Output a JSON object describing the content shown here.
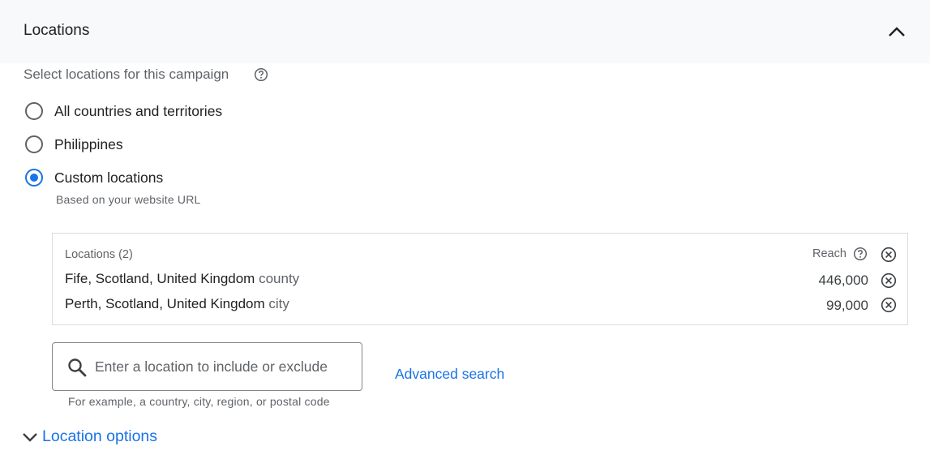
{
  "section": {
    "title": "Locations",
    "subtitle": "Select locations for this campaign"
  },
  "radios": {
    "options": [
      {
        "label": "All countries and territories",
        "checked": false
      },
      {
        "label": "Philippines",
        "checked": false
      },
      {
        "label": "Custom locations",
        "checked": true,
        "sublabel": "Based on your website URL"
      }
    ]
  },
  "locations": {
    "header": "Locations (2)",
    "reach_label": "Reach",
    "rows": [
      {
        "name": "Fife, Scotland, United Kingdom",
        "type": "county",
        "reach": "446,000"
      },
      {
        "name": "Perth, Scotland, United Kingdom",
        "type": "city",
        "reach": "99,000"
      }
    ]
  },
  "search": {
    "placeholder": "Enter a location to include or exclude",
    "hint": "For example, a country, city, region, or postal code",
    "advanced_label": "Advanced search"
  },
  "options_toggle": {
    "label": "Location options"
  },
  "colors": {
    "accent": "#1a73e8",
    "header_bg": "#f8f9fa",
    "border": "#dadce0"
  }
}
